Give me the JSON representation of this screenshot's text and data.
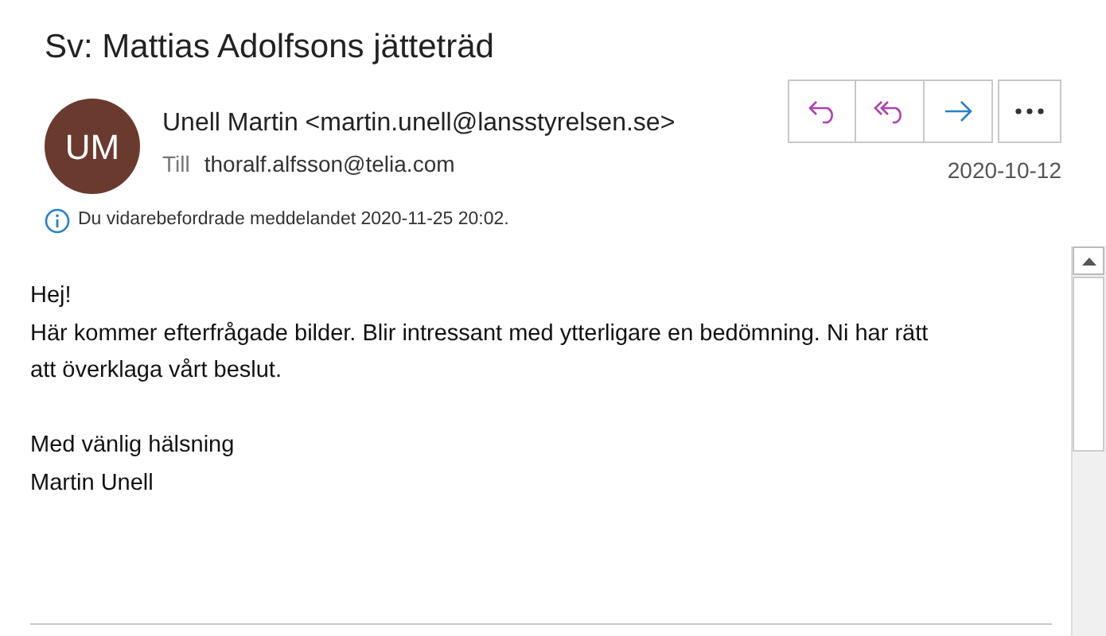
{
  "subject": "Sv: Mattias Adolfsons jätteträd",
  "sender": {
    "initials": "UM",
    "name": "Unell Martin <martin.unell@lansstyrelsen.se>",
    "to_label": "Till",
    "to": "thoralf.alfsson@telia.com",
    "date": "2020-10-12"
  },
  "actions": [
    {
      "kind": "reply"
    },
    {
      "kind": "reply_all"
    },
    {
      "kind": "forward"
    },
    {
      "kind": "more"
    }
  ],
  "info": "Du vidarebefordrade meddelandet 2020-11-25 20:02.",
  "body": [
    [
      "Hej!",
      "Här kommer efterfrågade bilder. Blir intressant med ytterligare en bedömning. Ni har rätt att överklaga vårt beslut."
    ],
    [
      "Med vänlig hälsning",
      "Martin Unell"
    ]
  ]
}
